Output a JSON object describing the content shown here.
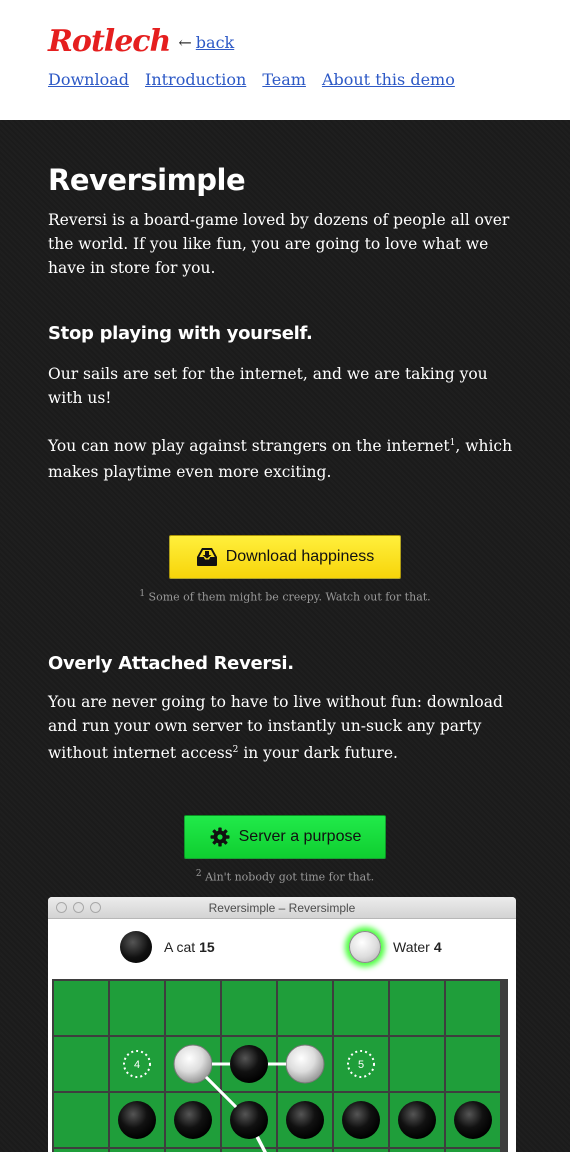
{
  "header": {
    "logo": "Rotlech",
    "back_arrow": "←",
    "back_label": "back",
    "nav": [
      "Download",
      "Introduction",
      "Team",
      "About this demo"
    ]
  },
  "content": {
    "title": "Reversimple",
    "intro": "Reversi is a board-game loved by dozens of people all over the world. If you like fun, you are going to love what we have in store for you.",
    "section1_heading": "Stop playing with yourself.",
    "section1_p1": "Our sails are set for the internet, and we are taking you with us!",
    "section1_p2_a": "You can now play against strangers on the internet",
    "section1_p2_sup": "1",
    "section1_p2_b": ", which makes playtime even more exciting.",
    "download_button": "Download happiness",
    "footnote1_num": "1",
    "footnote1": "Some of them might be creepy. Watch out for that.",
    "section2_heading": "Overly Attached Reversi.",
    "section2_p_a": "You are never going to have to live without fun: download and run your own server to instantly un-suck any party without internet access",
    "section2_p_sup": "2",
    "section2_p_b": " in your dark future.",
    "server_button": "Server a purpose",
    "footnote2_num": "2",
    "footnote2": "Ain't nobody got time for that."
  },
  "game_window": {
    "title": "Reversimple – Reversimple",
    "player1_name": "A cat",
    "player1_score": "15",
    "player2_name": "Water",
    "player2_score": "4",
    "hint_left": "4",
    "hint_right": "5"
  },
  "colors": {
    "logo": "#e51f1f",
    "link": "#2d59c6",
    "download_button": "#f7d50a",
    "server_button": "#0fce30",
    "board": "#1f9e3a"
  }
}
